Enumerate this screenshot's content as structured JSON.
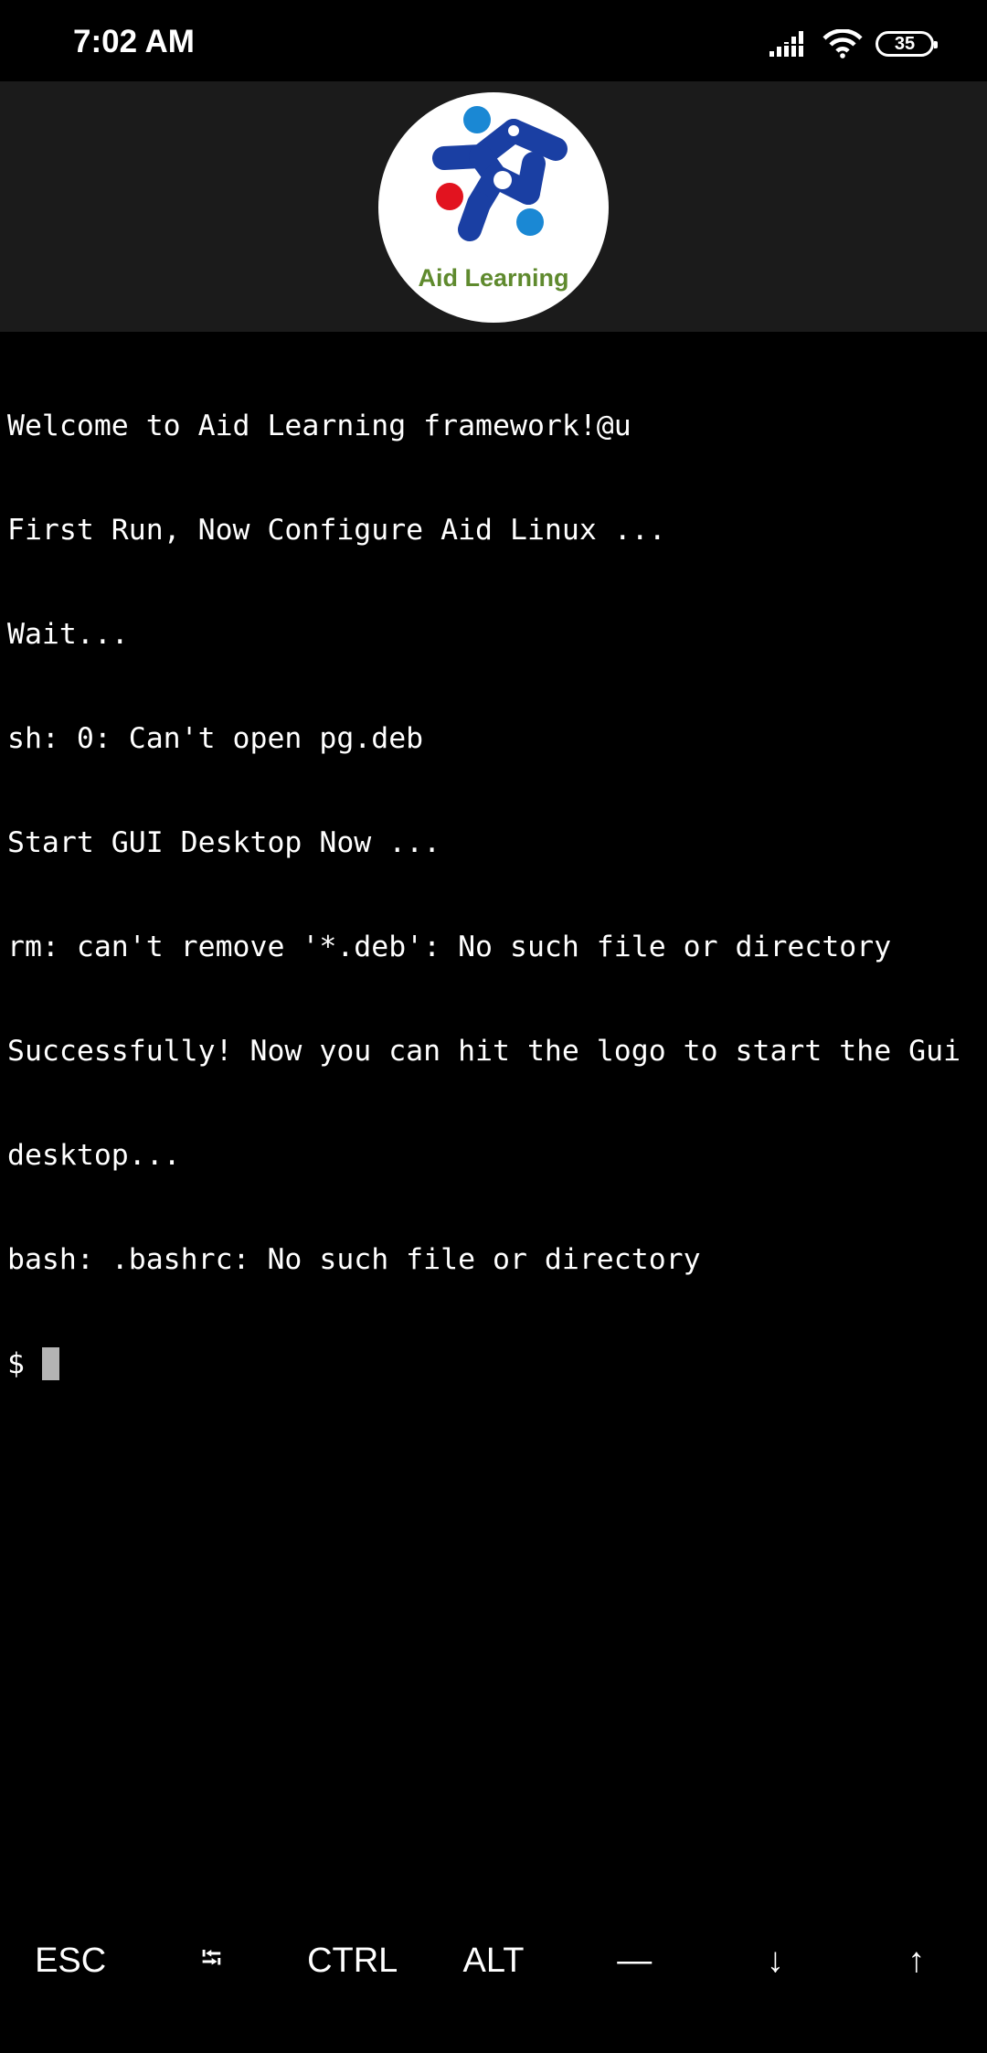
{
  "status_bar": {
    "time": "7:02 AM",
    "battery_level": "35",
    "signal_icon": "cellular-signal-icon",
    "wifi_icon": "wifi-icon"
  },
  "header": {
    "logo_text": "Aid Learning",
    "logo_colors": {
      "dark_blue": "#1a3fa3",
      "light_blue": "#1a88d4",
      "red": "#e2131f",
      "green_text": "#5f8a2e"
    }
  },
  "terminal": {
    "lines": [
      "Welcome to Aid Learning framework!@u",
      "First Run, Now Configure Aid Linux ...",
      "Wait...",
      "sh: 0: Can't open pg.deb",
      "Start GUI Desktop Now ...",
      "rm: can't remove '*.deb': No such file or directory",
      "Successfully! Now you can hit the logo to start the Gui",
      "desktop...",
      "bash: .bashrc: No such file or directory"
    ],
    "prompt": "$"
  },
  "extra_keys": [
    {
      "label": "ESC",
      "name": "esc-key"
    },
    {
      "label": "⭾",
      "name": "tab-key"
    },
    {
      "label": "CTRL",
      "name": "ctrl-key"
    },
    {
      "label": "ALT",
      "name": "alt-key"
    },
    {
      "label": "—",
      "name": "dash-key"
    },
    {
      "label": "↓",
      "name": "down-arrow-key"
    },
    {
      "label": "↑",
      "name": "up-arrow-key"
    }
  ]
}
